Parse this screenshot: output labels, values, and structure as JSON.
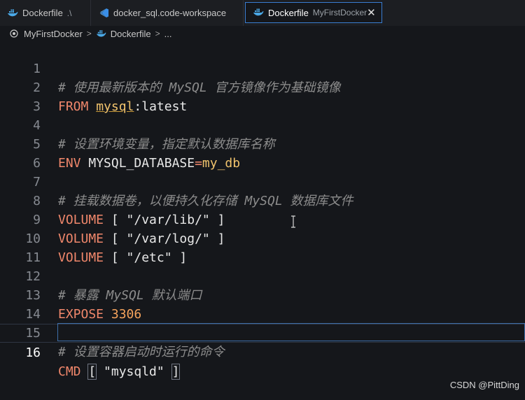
{
  "tabs": [
    {
      "label": "Dockerfile",
      "suffix": ".\\",
      "icon": "docker-icon"
    },
    {
      "label": "docker_sql.code-workspace",
      "icon": "vscode-icon"
    },
    {
      "label": "Dockerfile",
      "suffix": "MyFirstDocker",
      "icon": "docker-icon",
      "close": "✕"
    }
  ],
  "breadcrumb": {
    "folder": "MyFirstDocker",
    "file": "Dockerfile",
    "more": "..."
  },
  "lines": {
    "1": {
      "num": "1",
      "comment": "# 使用最新版本的 MySQL 官方镜像作为基础镜像"
    },
    "2": {
      "num": "2",
      "kw": "FROM",
      "image": "mysql",
      "rest": ":latest"
    },
    "3": {
      "num": "3"
    },
    "4": {
      "num": "4",
      "comment": "# 设置环境变量，指定默认数据库名称"
    },
    "5": {
      "num": "5",
      "kw": "ENV",
      "name": "MYSQL_DATABASE",
      "eq": "=",
      "val": "my_db"
    },
    "6": {
      "num": "6"
    },
    "7": {
      "num": "7",
      "comment": "# 挂载数据卷，以便持久化存储 MySQL 数据库文件"
    },
    "8": {
      "num": "8",
      "kw": "VOLUME",
      "rest": " [ \"/var/lib/\" ]"
    },
    "9": {
      "num": "9",
      "kw": "VOLUME",
      "rest": " [ \"/var/log/\" ]"
    },
    "10": {
      "num": "10",
      "kw": "VOLUME",
      "rest": " [ \"/etc\" ]"
    },
    "11": {
      "num": "11"
    },
    "12": {
      "num": "12",
      "comment": "# 暴露 MySQL 默认端口"
    },
    "13": {
      "num": "13",
      "kw": "EXPOSE",
      "val": "3306"
    },
    "14": {
      "num": "14"
    },
    "15": {
      "num": "15",
      "comment": "# 设置容器启动时运行的命令"
    },
    "16": {
      "num": "16",
      "kw": "CMD",
      "lb": "[",
      "mid": " \"mysqld\" ",
      "rb": "]"
    }
  },
  "watermark": "CSDN @PittDing",
  "colors": {
    "comment": "#8c8c8c",
    "keyword": "#f0876b",
    "value": "#f2c46d",
    "number": "#f5a35c",
    "accent": "#3a7dd1"
  }
}
